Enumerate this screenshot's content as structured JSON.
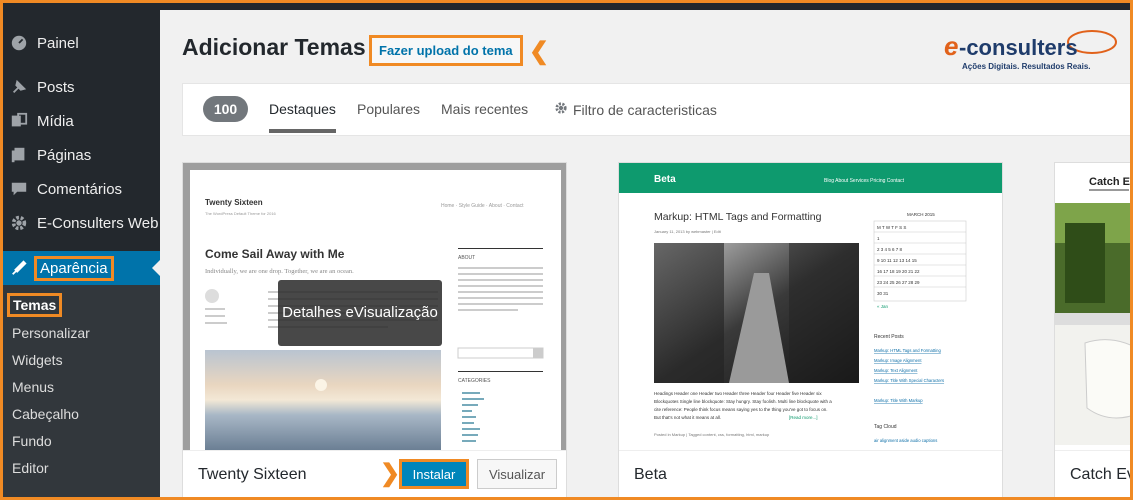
{
  "sidebar": {
    "items": [
      {
        "label": "Painel",
        "icon": "dashboard-icon"
      },
      {
        "label": "Posts",
        "icon": "pushpin-icon"
      },
      {
        "label": "Mídia",
        "icon": "media-icon"
      },
      {
        "label": "Páginas",
        "icon": "pages-icon"
      },
      {
        "label": "Comentários",
        "icon": "comment-icon"
      },
      {
        "label": "E-Consulters Web",
        "icon": "gear-icon"
      },
      {
        "label": "Aparência",
        "icon": "paintbrush-icon"
      }
    ],
    "submenu": [
      "Temas",
      "Personalizar",
      "Widgets",
      "Menus",
      "Cabeçalho",
      "Fundo",
      "Editor"
    ]
  },
  "header": {
    "title": "Adicionar Temas",
    "upload_label": "Fazer upload do tema",
    "logo_text": "e-consulters",
    "logo_tagline": "Ações Digitais. Resultados Reais."
  },
  "filter": {
    "count": "100",
    "tabs": [
      "Destaques",
      "Populares",
      "Mais recentes"
    ],
    "feature_filter": "Filtro de caracteristicas"
  },
  "themes": [
    {
      "name": "Twenty Sixteen",
      "install_label": "Instalar",
      "preview_label": "Visualizar",
      "overlay_label": "Detalhes e Visualização",
      "shot": {
        "site_title": "Twenty Sixteen",
        "tagline": "The WordPress Default Theme for 2016",
        "nav": [
          "Home",
          "Style Guide",
          "About",
          "Contact"
        ],
        "headline": "Come Sail Away with Me",
        "subhead": "Individually, we are one drop. Together, we are an ocean.",
        "widget_about": "ABOUT",
        "widget_categories": "CATEGORIES"
      }
    },
    {
      "name": "Beta",
      "shot": {
        "site_title": "Beta",
        "nav": [
          "Blog",
          "About",
          "Services",
          "Pricing",
          "Contact"
        ],
        "headline": "Markup: HTML Tags and Formatting",
        "meta": "January 11, 2013 by webmaster | Edit",
        "calendar_title": "MARCH 2015",
        "recent_posts_title": "Recent Posts",
        "recent_posts": [
          "Markup: HTML Tags and Formatting",
          "Markup: Image Alignment",
          "Markup: Text Alignment",
          "Markup: Title With Special Characters",
          "Markup: Title With Markup"
        ],
        "tag_cloud_title": "Tag Cloud",
        "excerpt": "Headings Header one Header two Header three Header four Header five Header six Blockquotes Single line blockquote: Stay hungry. Stay foolish. Multi line blockquote with a cite reference: People think focus means saying yes to the thing you've got to focus on. But that's not what it means at all.",
        "read_more": "[Read more...]"
      }
    },
    {
      "name": "Catch Ev",
      "shot": {
        "site_title": "Catch E"
      }
    }
  ],
  "colors": {
    "sidebar_bg": "#23282d",
    "accent": "#0073aa",
    "highlight": "#f08a24",
    "beta_green": "#0e9a6e"
  }
}
